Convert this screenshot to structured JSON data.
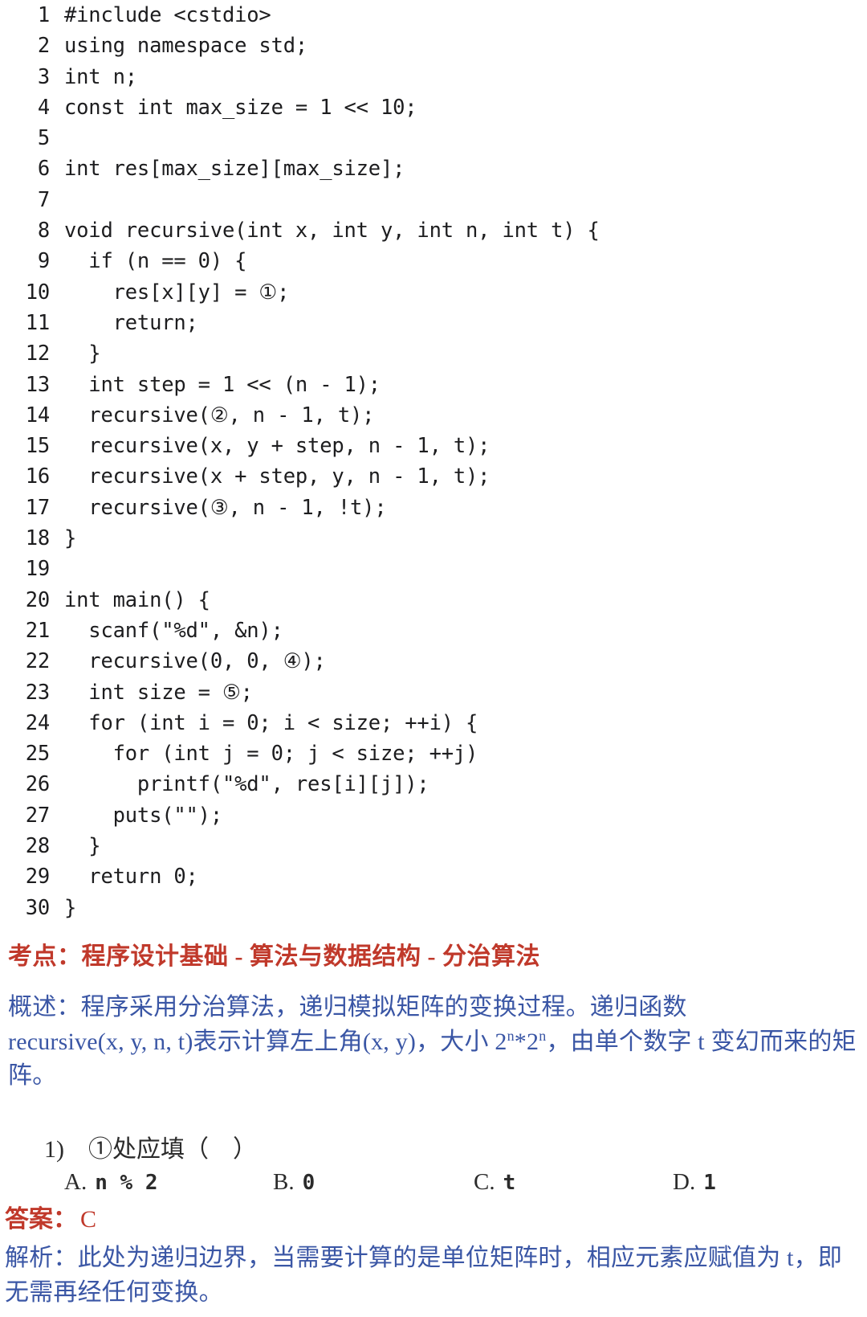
{
  "colors": {
    "code_text": "#1d1d1f",
    "red_accent": "#c0392b",
    "blue_text": "#3a56a5",
    "dark_text": "#2b2b2b",
    "background": "#ffffff"
  },
  "code": {
    "language": "C++",
    "lines": [
      {
        "no": "1",
        "text": "#include <cstdio>"
      },
      {
        "no": "2",
        "text": "using namespace std;"
      },
      {
        "no": "3",
        "text": "int n;"
      },
      {
        "no": "4",
        "text": "const int max_size = 1 << 10;"
      },
      {
        "no": "5",
        "text": ""
      },
      {
        "no": "6",
        "text": "int res[max_size][max_size];"
      },
      {
        "no": "7",
        "text": ""
      },
      {
        "no": "8",
        "text": "void recursive(int x, int y, int n, int t) {"
      },
      {
        "no": "9",
        "text": "  if (n == 0) {"
      },
      {
        "no": "10",
        "text": "    res[x][y] = ①;"
      },
      {
        "no": "11",
        "text": "    return;"
      },
      {
        "no": "12",
        "text": "  }"
      },
      {
        "no": "13",
        "text": "  int step = 1 << (n - 1);"
      },
      {
        "no": "14",
        "text": "  recursive(②, n - 1, t);"
      },
      {
        "no": "15",
        "text": "  recursive(x, y + step, n - 1, t);"
      },
      {
        "no": "16",
        "text": "  recursive(x + step, y, n - 1, t);"
      },
      {
        "no": "17",
        "text": "  recursive(③, n - 1, !t);"
      },
      {
        "no": "18",
        "text": "}"
      },
      {
        "no": "19",
        "text": ""
      },
      {
        "no": "20",
        "text": "int main() {"
      },
      {
        "no": "21",
        "text": "  scanf(\"%d\", &n);"
      },
      {
        "no": "22",
        "text": "  recursive(0, 0, ④);"
      },
      {
        "no": "23",
        "text": "  int size = ⑤;"
      },
      {
        "no": "24",
        "text": "  for (int i = 0; i < size; ++i) {"
      },
      {
        "no": "25",
        "text": "    for (int j = 0; j < size; ++j)"
      },
      {
        "no": "26",
        "text": "      printf(\"%d\", res[i][j]);"
      },
      {
        "no": "27",
        "text": "    puts(\"\");"
      },
      {
        "no": "28",
        "text": "  }"
      },
      {
        "no": "29",
        "text": "  return 0;"
      },
      {
        "no": "30",
        "text": "}"
      }
    ]
  },
  "topic": {
    "label": "考点：",
    "value": "程序设计基础 - 算法与数据结构 - 分治算法",
    "full": "考点：程序设计基础 - 算法与数据结构 - 分治算法"
  },
  "overview": {
    "label": "概述：",
    "part1": "概述：程序采用分治算法，递归模拟矩阵的变换过程。递归函数",
    "part2_before": "recursive(x, y, n, t)表示计算左上角(x, y)，大小 2",
    "sup1": "n",
    "part2_mid": "*2",
    "sup2": "n",
    "part2_after": "，由单个数字 t 变幻而来的矩阵。"
  },
  "question": {
    "number": "1)",
    "text": "①处应填（　）",
    "full": "1)　①处应填（　）"
  },
  "options": [
    {
      "key": "A.",
      "value": "n % 2"
    },
    {
      "key": "B.",
      "value": "0"
    },
    {
      "key": "C.",
      "value": "t"
    },
    {
      "key": "D.",
      "value": "1"
    }
  ],
  "answer": {
    "label": "答案：",
    "value": "C"
  },
  "explanation": {
    "label": "解析：",
    "full": "解析：此处为递归边界，当需要计算的是单位矩阵时，相应元素应赋值为 t，即无需再经任何变换。"
  }
}
